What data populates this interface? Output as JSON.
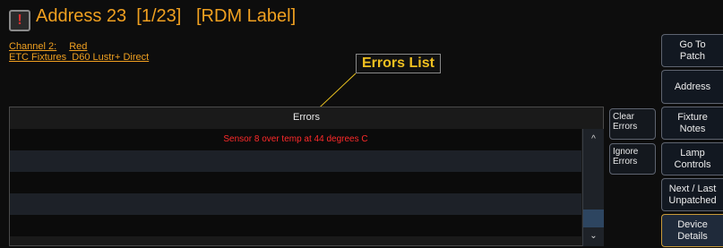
{
  "header": {
    "alert_icon_glyph": "!",
    "title": "Address 23  [1/23]   [RDM Label]",
    "channel_label": "Channel 2:",
    "channel_value": "Red",
    "fixture_line": "ETC Fixtures  D60 Lustr+ Direct"
  },
  "annotation": {
    "label": "Errors List"
  },
  "errors": {
    "header": "Errors",
    "rows": [
      "Sensor 8 over temp at 44 degrees C",
      "",
      "",
      "",
      "",
      ""
    ],
    "scroll_up_glyph": "^",
    "scroll_down_glyph": "⌄"
  },
  "side_buttons": {
    "clear": [
      "Clear",
      "Errors"
    ],
    "ignore": [
      "Ignore",
      "Errors"
    ]
  },
  "right_panel": {
    "goto_patch": [
      "Go To",
      "Patch"
    ],
    "address": [
      "Address"
    ],
    "fixture_notes": [
      "Fixture",
      "Notes"
    ],
    "lamp_controls": [
      "Lamp",
      "Controls"
    ],
    "next_last": [
      "Next / Last",
      "Unpatched"
    ],
    "device_details": [
      "Device",
      "Details"
    ]
  },
  "colors": {
    "accent": "#f0a020",
    "error_text": "#ff2a2a",
    "annotation_text": "#f0c020"
  }
}
